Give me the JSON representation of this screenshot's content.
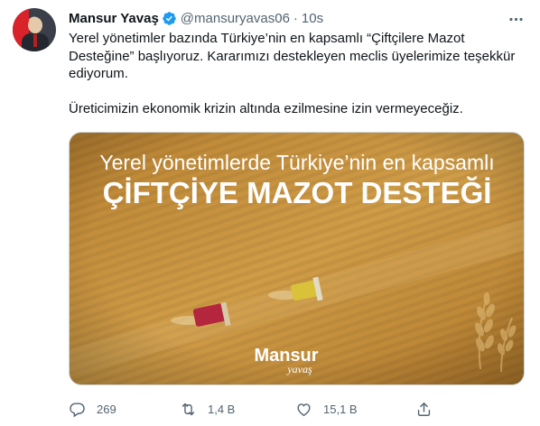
{
  "tweet": {
    "author_name": "Mansur Yavaş",
    "handle": "@mansuryavas06",
    "separator": "·",
    "time": "10s",
    "paragraph1": "Yerel yönetimler bazında Türkiye’nin en kapsamlı “Çiftçilere Mazot Desteğine” başlıyoruz. Kararımızı destekleyen meclis üyelerimize teşekkür ediyorum.",
    "paragraph2": "Üreticimizin ekonomik krizin altında ezilmesine izin vermeyeceğiz."
  },
  "media": {
    "headline_line1": "Yerel yönetimlerde Türkiye’nin en kapsamlı",
    "headline_line2": "ÇİFTÇİYE MAZOT DESTEĞİ",
    "logo_name": "Mansur",
    "logo_sub": "yavaş",
    "colors": {
      "field": "#c38f3b",
      "field_dark": "#a5732a",
      "text": "#ffffff"
    }
  },
  "actions": {
    "reply_count": "269",
    "retweet_count": "1,4 B",
    "like_count": "15,1 B"
  },
  "colors": {
    "accent": "#1d9bf0",
    "secondary_text": "#536471"
  }
}
